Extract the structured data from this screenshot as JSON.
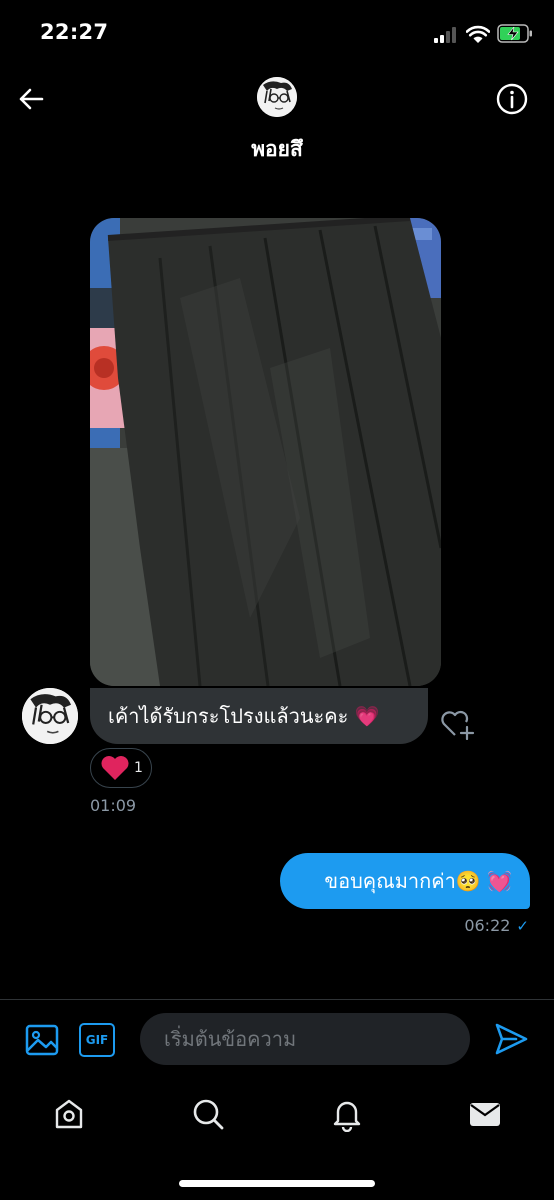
{
  "status": {
    "time": "22:27"
  },
  "header": {
    "name": "พอยสึ"
  },
  "messages": {
    "incoming": {
      "text": "เค้าได้รับกระโปรงแล้วนะคะ 💗",
      "reaction_emoji": "heart",
      "reaction_count": "1",
      "time": "01:09"
    },
    "outgoing": {
      "text": "ขอบคุณมากค่า🥺 💓",
      "time": "06:22",
      "status_icon": "check-icon"
    }
  },
  "composer": {
    "gif_label": "GIF",
    "placeholder": "เริ่มต้นข้อความ"
  },
  "colors": {
    "accent": "#1d9bf0",
    "bubble_in": "#2f3336",
    "background": "#000000"
  }
}
